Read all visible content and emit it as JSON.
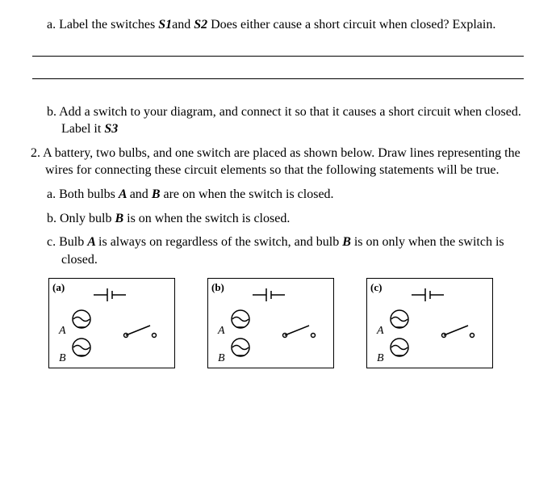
{
  "q1a_label": "a.",
  "q1a_text_1": "Label the switches ",
  "q1a_s1": "S1",
  "q1a_text_2": "and ",
  "q1a_s2": "S2",
  "q1a_text_3": " Does either cause a short circuit when closed? Explain.",
  "q1b_label": "b.",
  "q1b_text_1": "Add a switch to your diagram, and connect it so that it causes a short circuit when closed. Label it ",
  "q1b_s3": "S3",
  "q2_label": "2.",
  "q2_text": "A battery, two bulbs, and one switch are placed as shown below. Draw lines representing the wires for connecting these circuit elements so that the following statements will be true.",
  "q2a_label": "a.",
  "q2a_text_1": "Both bulbs ",
  "q2a_A": "A ",
  "q2a_text_2": "and ",
  "q2a_B": "B ",
  "q2a_text_3": "are on when the switch is closed.",
  "q2b_label": "b.",
  "q2b_text_1": "Only bulb ",
  "q2b_B": "B ",
  "q2b_text_2": "is on when the switch is closed.",
  "q2c_label": "c.",
  "q2c_text_1": "Bulb ",
  "q2c_A": "A ",
  "q2c_text_2": "is always on regardless of the switch, and bulb ",
  "q2c_B": "B ",
  "q2c_text_3": "is on only when the switch is closed.",
  "figs": {
    "a": {
      "label": "(a)",
      "A": "A",
      "B": "B"
    },
    "b": {
      "label": "(b)",
      "A": "A",
      "B": "B"
    },
    "c": {
      "label": "(c)",
      "A": "A",
      "B": "B"
    }
  }
}
